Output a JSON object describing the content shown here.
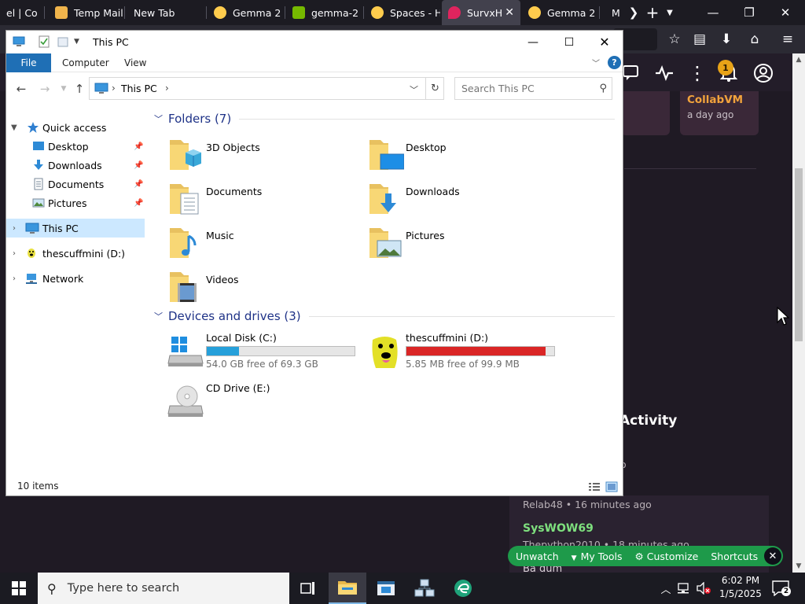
{
  "browser": {
    "tabs": [
      {
        "label": "el | Co",
        "active": false
      },
      {
        "label": "Temp Mail",
        "active": false
      },
      {
        "label": "New Tab",
        "active": false
      },
      {
        "label": "Gemma 2",
        "active": false
      },
      {
        "label": "gemma-2",
        "active": false
      },
      {
        "label": "Spaces - H",
        "active": false
      },
      {
        "label": "SurvxH",
        "active": true
      },
      {
        "label": "Gemma 2",
        "active": false
      },
      {
        "label": "M",
        "active": false
      }
    ],
    "controls": {
      "minimize": "—",
      "maximize": "❐",
      "close": "✕"
    }
  },
  "site": {
    "card": {
      "title": "CollabVM",
      "subtitle": "a day ago"
    },
    "notification_count": "1",
    "activity_heading": "Activity",
    "activity": [
      {
        "meta": "o",
        "user": ""
      },
      {
        "meta": "Relab48 • 16 minutes ago"
      },
      {
        "user": "SysWOW69",
        "meta": "Thepython2010 • 18 minutes ago"
      }
    ],
    "fragment": "Ba dum",
    "pills": {
      "unwatch": "Unwatch",
      "tools": "My Tools",
      "customize": "Customize",
      "shortcuts": "Shortcuts"
    }
  },
  "explorer": {
    "title": "This PC",
    "ribbon_tabs": {
      "file": "File",
      "computer": "Computer",
      "view": "View"
    },
    "address": "This PC",
    "search_placeholder": "Search This PC",
    "nav": {
      "quick_access": "Quick access",
      "desktop": "Desktop",
      "downloads": "Downloads",
      "documents": "Documents",
      "pictures": "Pictures",
      "this_pc": "This PC",
      "drive_d": "thescuffmini (D:)",
      "network": "Network"
    },
    "folders_header": "Folders (7)",
    "folders": [
      "3D Objects",
      "Desktop",
      "Documents",
      "Downloads",
      "Music",
      "Pictures",
      "Videos"
    ],
    "devices_header": "Devices and drives (3)",
    "drives": [
      {
        "name": "Local Disk (C:)",
        "free": "54.0 GB free of 69.3 GB",
        "used_fraction": 0.22,
        "bar_color": "#26a0da"
      },
      {
        "name": "thescuffmini (D:)",
        "free": "5.85 MB free of 99.9 MB",
        "used_fraction": 0.94,
        "bar_color": "#da2626"
      },
      {
        "name": "CD Drive (E:)"
      }
    ],
    "status": "10 items"
  },
  "taskbar": {
    "search_placeholder": "Type here to search",
    "time": "6:02 PM",
    "date": "1/5/2025",
    "notification_count": "2"
  }
}
